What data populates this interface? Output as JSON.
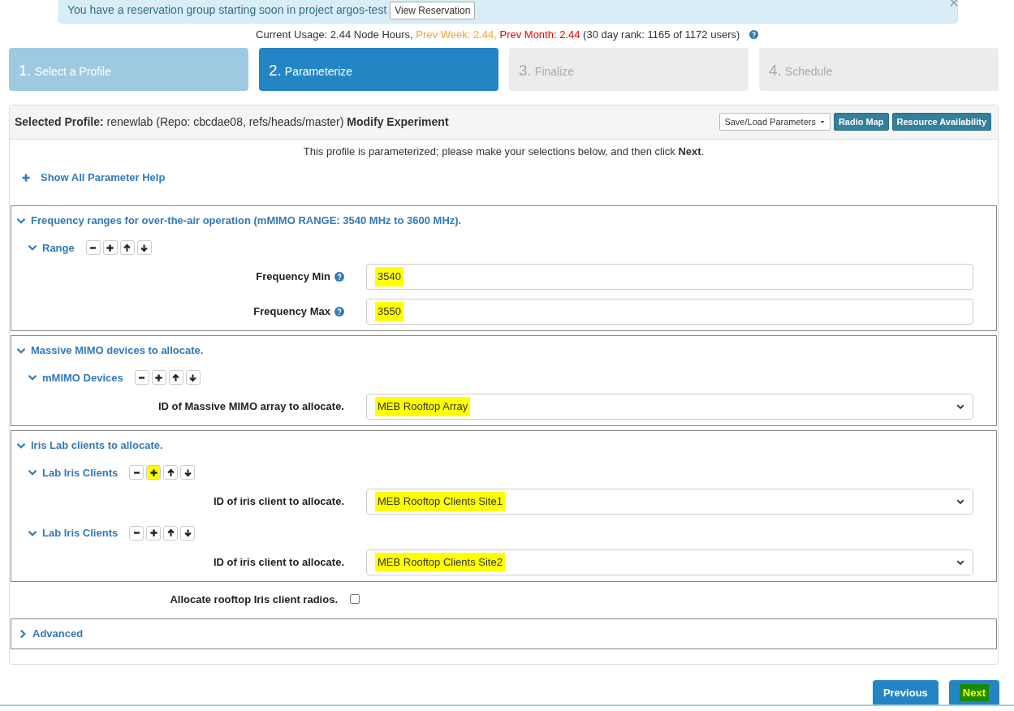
{
  "alert": {
    "message": "You have a reservation group starting soon in project argos-test",
    "button": "View Reservation",
    "close": "×"
  },
  "usage": {
    "current": "Current Usage: 2.44 Node Hours,",
    "prev_week": "Prev Week: 2.44,",
    "prev_month": "Prev Month: 2.44",
    "rank": "(30 day rank: 1165 of 1172 users)"
  },
  "steps": [
    {
      "number": "1.",
      "label": "Select a Profile",
      "completed": true,
      "selected": false
    },
    {
      "number": "2.",
      "label": "Parameterize",
      "completed": false,
      "selected": true
    },
    {
      "number": "3.",
      "label": "Finalize",
      "completed": false,
      "selected": false
    },
    {
      "number": "4.",
      "label": "Schedule",
      "completed": false,
      "selected": false
    }
  ],
  "panel": {
    "heading": "**Selected Profile:** renewlab (Repo: cbcdae08, refs/heads/master) **Modify Experiment**",
    "buttons": [
      {
        "label": "Save/Load Parameters",
        "kind": "dropdown"
      },
      {
        "label": "Radio Map",
        "kind": "primary"
      },
      {
        "label": "Resource Availability",
        "kind": "primary"
      }
    ],
    "intro": "This profile is parameterized; please make your selections below, and then click **Next**.",
    "help_link": "Show All Parameter Help",
    "groups": [
      {
        "title": "Frequency ranges for over-the-air operation (mMIMO RANGE: 3540 MHz to 3600 MHz).",
        "expanded": true,
        "children": [
          {
            "label": "Range",
            "expanded": true,
            "plus_highlighted": false,
            "fields": [
              {
                "label": "Frequency Min",
                "help": true,
                "kind": "text",
                "value": "3540",
                "highlighted": true
              },
              {
                "label": "Frequency Max",
                "help": true,
                "kind": "text",
                "value": "3550",
                "highlighted": true
              }
            ]
          }
        ]
      },
      {
        "title": "Massive MIMO devices to allocate.",
        "expanded": true,
        "children": [
          {
            "label": "mMIMO Devices",
            "expanded": true,
            "plus_highlighted": false,
            "fields": [
              {
                "label": "ID of Massive MIMO array to allocate.",
                "help": false,
                "kind": "select",
                "value": "MEB Rooftop Array",
                "highlighted": true
              }
            ]
          }
        ]
      },
      {
        "title": "Iris Lab clients to allocate.",
        "expanded": true,
        "children": [
          {
            "label": "Lab Iris Clients",
            "expanded": true,
            "plus_highlighted": true,
            "fields": [
              {
                "label": "ID of iris client to allocate.",
                "help": false,
                "kind": "select",
                "value": "MEB Rooftop Clients Site1",
                "highlighted": true
              }
            ]
          },
          {
            "label": "Lab Iris Clients",
            "expanded": true,
            "plus_highlighted": false,
            "fields": [
              {
                "label": "ID of iris client to allocate.",
                "help": false,
                "kind": "select",
                "value": "MEB Rooftop Clients Site2",
                "highlighted": true
              }
            ]
          }
        ]
      }
    ],
    "checkbox": {
      "label": "Allocate rooftop Iris client radios.",
      "checked": false
    },
    "advanced": {
      "title": "Advanced",
      "expanded": false
    }
  },
  "footer": [
    {
      "label": "Previous",
      "highlighted": false
    },
    {
      "label": "Next",
      "highlighted": true
    }
  ]
}
